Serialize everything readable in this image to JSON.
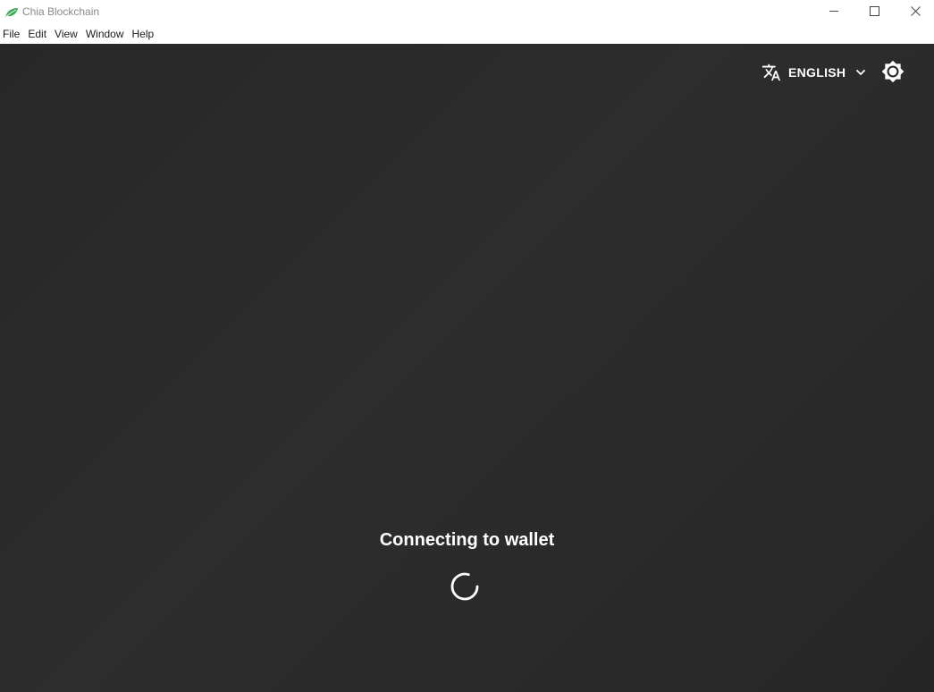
{
  "window": {
    "title": "Chia Blockchain",
    "controls": {
      "minimize_icon": "minimize-icon",
      "maximize_icon": "maximize-icon",
      "close_icon": "close-icon"
    }
  },
  "menubar": {
    "items": [
      {
        "label": "File"
      },
      {
        "label": "Edit"
      },
      {
        "label": "View"
      },
      {
        "label": "Window"
      },
      {
        "label": "Help"
      }
    ]
  },
  "header": {
    "language": {
      "label": "ENGLISH",
      "icon": "translate-icon",
      "chevron": "chevron-down-icon"
    },
    "theme_toggle_icon": "brightness-icon"
  },
  "status": {
    "message": "Connecting to wallet",
    "spinner_icon": "loading-spinner-icon"
  },
  "colors": {
    "background": "#2a2a2a",
    "foreground": "#ffffff",
    "brand": "#3aac59",
    "titlebar_text": "#8a8a8a"
  }
}
